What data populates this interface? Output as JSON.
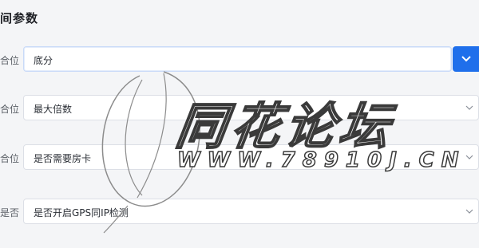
{
  "section": {
    "title": "间参数"
  },
  "rows": [
    {
      "label": "合位",
      "value": "底分"
    },
    {
      "label": "合位",
      "value": "最大倍数"
    },
    {
      "label": "合位",
      "value": "是否需要房卡"
    },
    {
      "label": "是否",
      "value": "是否开启GPS同IP检测"
    }
  ],
  "watermark": {
    "title": "同花论坛",
    "url": "WWW.78910J.CN"
  },
  "colors": {
    "accent": "#1f6feb",
    "border": "#dcdfe6",
    "background": "#f4f5f7"
  }
}
